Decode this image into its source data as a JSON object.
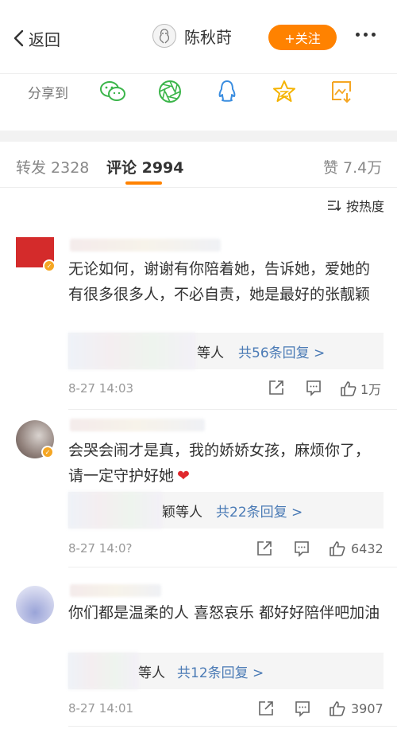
{
  "header": {
    "back_label": "返回",
    "profile_name": "陈秋莳",
    "follow_label": "+关注"
  },
  "share": {
    "label": "分享到",
    "targets": [
      "wechat-icon",
      "moments-icon",
      "qq-icon",
      "qzone-icon",
      "save-image-icon"
    ],
    "accent": "#3bb54a"
  },
  "tabs": {
    "repost": "转发 2328",
    "comment": "评论 2994",
    "like": "赞 7.4万"
  },
  "sort_label": "按热度",
  "accent_color": "#ff8200",
  "comments": [
    {
      "text": "无论如何，谢谢有你陪着她，告诉她，爱她的有很多很多人，不必自责，她是最好的张靓颖",
      "reply_who": "等人",
      "reply_count": "共56条回复 >",
      "time": "8-27 14:03",
      "likes": "1万"
    },
    {
      "text": "会哭会闹才是真，我的娇娇女孩，麻烦你了，请一定守护好她",
      "reply_who": "颖等人",
      "reply_count": "共22条回复 >",
      "time": "8-27 14:0?",
      "likes": "6432"
    },
    {
      "text": "你们都是温柔的人 喜怒哀乐 都好好陪伴吧加油",
      "reply_who": "等人",
      "reply_count": "共12条回复 >",
      "time": "8-27 14:01",
      "likes": "3907"
    }
  ]
}
